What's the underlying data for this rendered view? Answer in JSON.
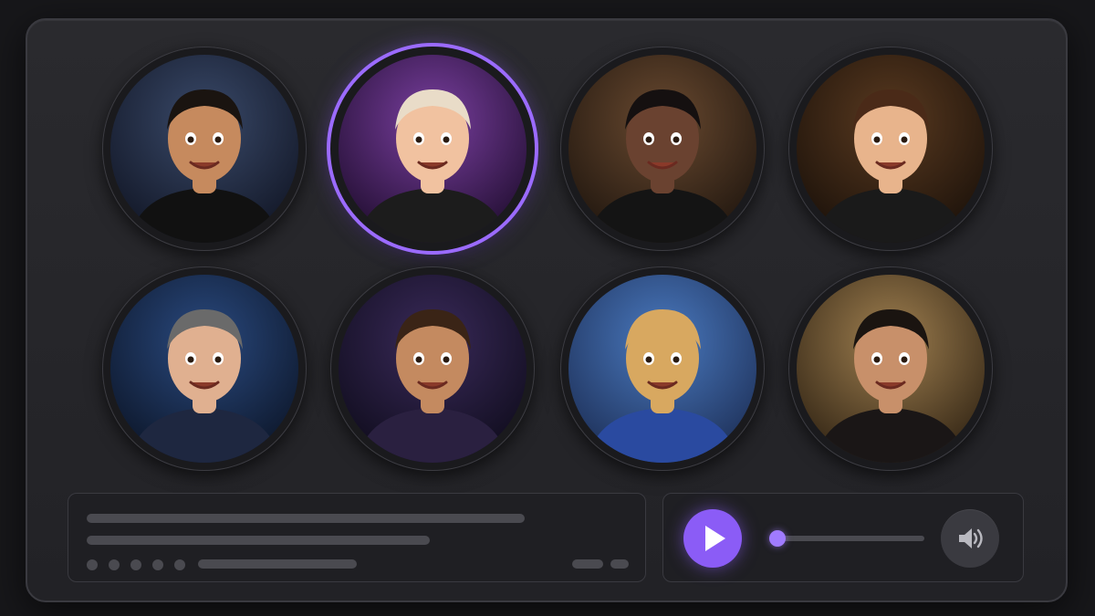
{
  "theme": {
    "accent": "#8b5cf6",
    "background": "#17171a",
    "panel": "#222226"
  },
  "avatars": [
    {
      "name": "soccer-player",
      "active": false,
      "bg1": "#3a4a6a",
      "bg2": "#0e1220",
      "skin": "#c68a5e",
      "hair": "#1a1410",
      "shirt": "#111111"
    },
    {
      "name": "pop-singer",
      "active": true,
      "bg1": "#7a3fa0",
      "bg2": "#1a0a28",
      "skin": "#f1c2a0",
      "hair": "#e9dcc8",
      "shirt": "#1c1c1c"
    },
    {
      "name": "rapper",
      "active": false,
      "bg1": "#6a4a30",
      "bg2": "#1a120c",
      "skin": "#6a4230",
      "hair": "#151010",
      "shirt": "#141414"
    },
    {
      "name": "comedian",
      "active": false,
      "bg1": "#5a3a20",
      "bg2": "#160e08",
      "skin": "#e8b48c",
      "hair": "#4a2a18",
      "shirt": "#1a1a1a"
    },
    {
      "name": "news-anchor",
      "active": false,
      "bg1": "#2a4a80",
      "bg2": "#0a1222",
      "skin": "#e0b090",
      "hair": "#6a6a6a",
      "shirt": "#1e2740"
    },
    {
      "name": "gamer",
      "active": false,
      "bg1": "#3a2a5a",
      "bg2": "#0c0a18",
      "skin": "#c48a60",
      "hair": "#3a2416",
      "shirt": "#2a2040"
    },
    {
      "name": "mascot",
      "active": false,
      "bg1": "#4a7ac0",
      "bg2": "#1a2a50",
      "skin": "#d8a860",
      "hair": "#d8a860",
      "shirt": "#2a4aa0"
    },
    {
      "name": "actor",
      "active": false,
      "bg1": "#a08050",
      "bg2": "#2a1e10",
      "skin": "#c8906a",
      "hair": "#1a1410",
      "shirt": "#1a1616"
    }
  ],
  "player": {
    "progress": 0.05,
    "play_icon": "play-icon",
    "volume_icon": "volume-icon"
  }
}
